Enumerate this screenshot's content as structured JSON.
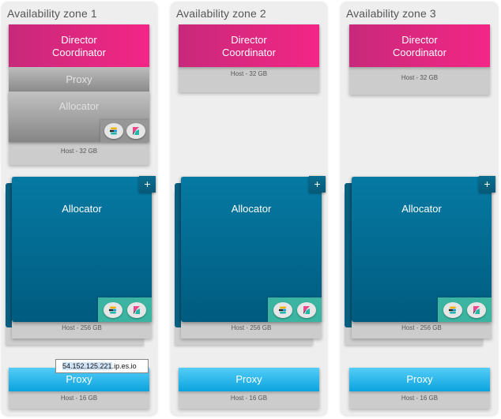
{
  "colors": {
    "director": "#e8267f",
    "allocator": "#006b93",
    "proxy": "#1bb4ec",
    "host": "#cccccc",
    "badge_teal": "#3bb5a1",
    "zone_bg": "#eeeeee"
  },
  "zones": [
    {
      "title": "Availability zone 1",
      "small_host": {
        "director_line1": "Director",
        "director_line2": "Coordinator",
        "proxy_label": "Proxy",
        "allocator_label": "Allocator",
        "badges": [
          "elasticsearch-icon",
          "kibana-icon"
        ],
        "host_label": "Host - 32 GB"
      },
      "allocator": {
        "label": "Allocator",
        "add_label": "+",
        "badges": [
          "elasticsearch-icon",
          "kibana-icon"
        ],
        "host_label": "Host - 256 GB"
      },
      "proxy": {
        "label": "Proxy",
        "host_label": "Host - 16 GB",
        "tooltip_selected": "54.152.125.221",
        "tooltip_rest": ".ip.es.io"
      }
    },
    {
      "title": "Availability zone 2",
      "small_host": {
        "director_line1": "Director",
        "director_line2": "Coordinator",
        "host_label": "Host - 32 GB"
      },
      "allocator": {
        "label": "Allocator",
        "add_label": "+",
        "badges": [
          "elasticsearch-icon",
          "kibana-icon"
        ],
        "host_label": "Host - 256 GB"
      },
      "proxy": {
        "label": "Proxy",
        "host_label": "Host - 16 GB"
      }
    },
    {
      "title": "Availability zone 3",
      "small_host": {
        "director_line1": "Director",
        "director_line2": "Coordinator",
        "host_label": "Host - 32 GB"
      },
      "allocator": {
        "label": "Allocator",
        "add_label": "+",
        "badges": [
          "elasticsearch-icon",
          "kibana-icon"
        ],
        "host_label": "Host - 256 GB"
      },
      "proxy": {
        "label": "Proxy",
        "host_label": "Host - 16 GB"
      }
    }
  ]
}
